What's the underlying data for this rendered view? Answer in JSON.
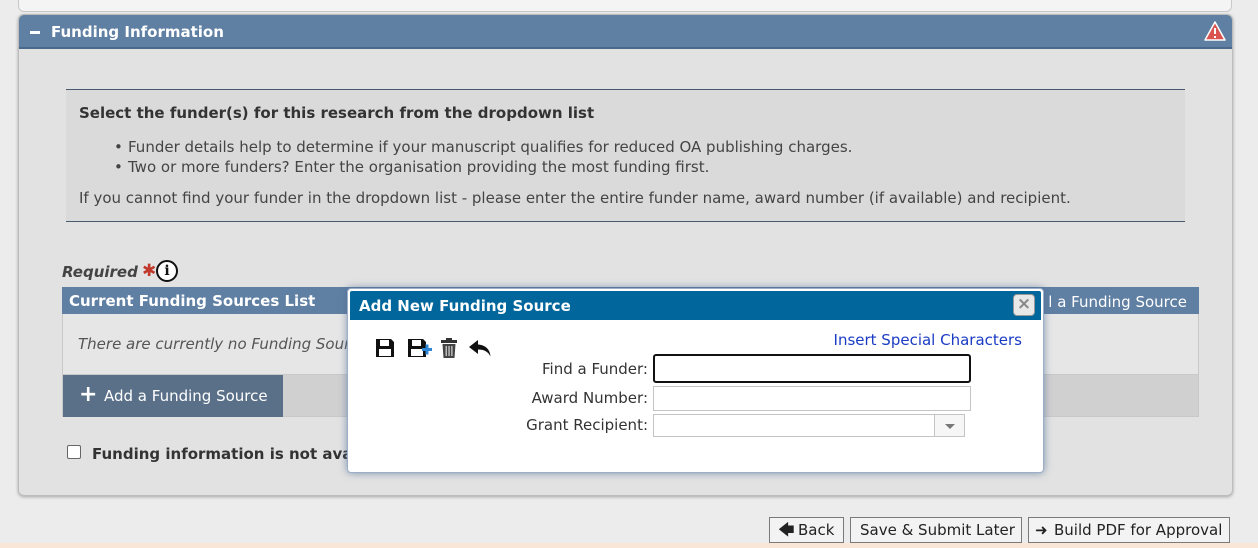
{
  "section": {
    "title": "Funding Information"
  },
  "instructions": {
    "heading": "Select the funder(s) for this research from the dropdown list",
    "bullets": [
      "Funder details help to determine if your manuscript qualifies for reduced OA publishing charges.",
      "Two or more funders? Enter the organisation providing the most funding first."
    ],
    "note": "If you cannot find your funder in the dropdown list - please enter the entire funder name, award number (if available) and recipient."
  },
  "required": {
    "label": "Required",
    "star": "✱",
    "info": "i"
  },
  "sources": {
    "title": "Current Funding Sources List",
    "add_right_label": "l a Funding Source",
    "empty_text": "There are currently no Funding Sources",
    "add_button_label": "Add a Funding Source"
  },
  "not_available": {
    "label": "Funding information is not available"
  },
  "dialog": {
    "title": "Add New Funding Source",
    "special_chars_label": "Insert Special Characters",
    "fields": {
      "funder_label": "Find a Funder:",
      "funder_value": "",
      "award_label": "Award Number:",
      "award_value": "",
      "recipient_label": "Grant Recipient:",
      "recipient_value": ""
    },
    "toolbar_icons": [
      "save-icon",
      "save-and-add-icon",
      "trash-icon",
      "undo-icon"
    ]
  },
  "footer": {
    "back_label": "Back",
    "later_label": "Save & Submit Later",
    "pdf_label": "Build PDF for Approval"
  },
  "colors": {
    "header_blue": "#5f7fa3",
    "dialog_blue": "#00669c",
    "link_blue": "#1a3bc4",
    "required_red": "#c0392b",
    "warning_red": "#d9534f"
  }
}
